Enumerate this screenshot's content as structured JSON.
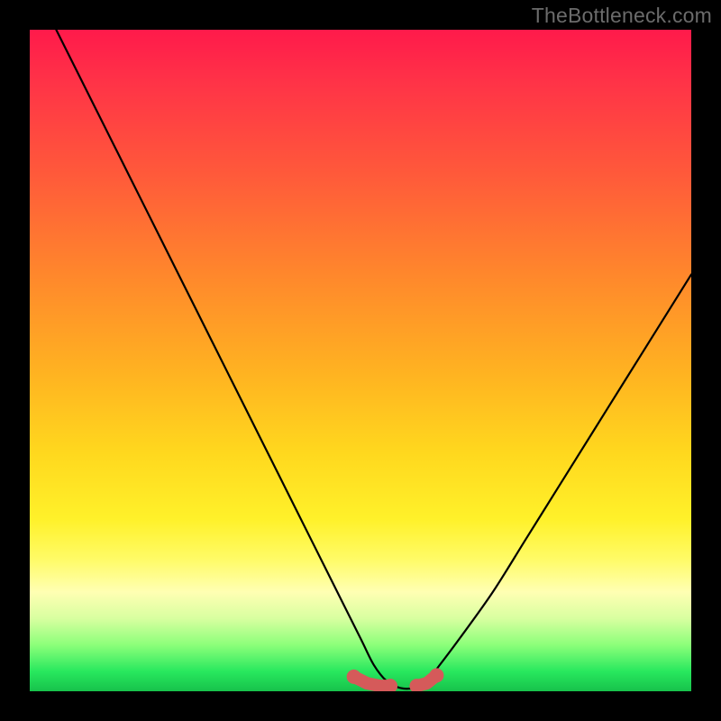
{
  "watermark": "TheBottleneck.com",
  "chart_data": {
    "type": "line",
    "title": "",
    "xlabel": "",
    "ylabel": "",
    "xlim": [
      0,
      100
    ],
    "ylim": [
      0,
      100
    ],
    "grid": false,
    "legend": false,
    "background": "vertical-spectrum-red-to-green",
    "series": [
      {
        "name": "bottleneck-curve",
        "color": "#000000",
        "x": [
          4,
          10,
          15,
          20,
          25,
          30,
          35,
          40,
          45,
          50,
          52,
          54,
          56,
          58,
          60,
          62,
          65,
          70,
          75,
          80,
          85,
          90,
          95,
          100
        ],
        "y": [
          100,
          88,
          78,
          68,
          58,
          48,
          38,
          28,
          18,
          8,
          4,
          1.5,
          0.5,
          0.5,
          1.5,
          4,
          8,
          15,
          23,
          31,
          39,
          47,
          55,
          63
        ]
      }
    ],
    "markers": [
      {
        "name": "left-foot-marker",
        "color": "#d55a5a",
        "x": [
          49,
          51,
          53,
          54.5
        ],
        "y": [
          2.2,
          1.2,
          0.8,
          0.8
        ]
      },
      {
        "name": "right-foot-marker",
        "color": "#d55a5a",
        "x": [
          58.5,
          60,
          61.5
        ],
        "y": [
          0.8,
          1.2,
          2.4
        ]
      }
    ]
  }
}
